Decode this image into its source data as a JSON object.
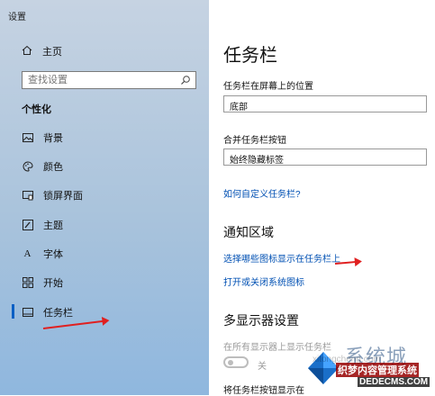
{
  "window": {
    "title": "设置"
  },
  "sidebar": {
    "home_label": "主页",
    "search_placeholder": "查找设置",
    "section_title": "个性化",
    "items": [
      {
        "label": "背景",
        "icon": "picture-icon"
      },
      {
        "label": "颜色",
        "icon": "palette-icon"
      },
      {
        "label": "锁屏界面",
        "icon": "lock-screen-icon"
      },
      {
        "label": "主题",
        "icon": "brush-icon"
      },
      {
        "label": "字体",
        "icon": "font-icon"
      },
      {
        "label": "开始",
        "icon": "start-icon"
      },
      {
        "label": "任务栏",
        "icon": "taskbar-icon",
        "active": true
      }
    ]
  },
  "main": {
    "title": "任务栏",
    "position_label": "任务栏在屏幕上的位置",
    "position_value": "底部",
    "combine_label": "合并任务栏按钮",
    "combine_value": "始终隐藏标签",
    "customize_link": "如何自定义任务栏?",
    "notification_heading": "通知区域",
    "select_icons_link": "选择哪些图标显示在任务栏上",
    "system_icons_link": "打开或关闭系统图标",
    "multi_display_heading": "多显示器设置",
    "show_all_label": "在所有显示器上显示任务栏",
    "toggle_state": "关",
    "show_buttons_label": "将任务栏按钮显示在"
  },
  "watermark": {
    "big": "系统城",
    "text1": "织梦内容管理系统",
    "text2": "DEDECMS.COM",
    "url": "xitongcheng.com"
  },
  "colors": {
    "accent": "#0a5fc4",
    "link": "#0050b3",
    "annotation_arrow": "#e02020"
  }
}
